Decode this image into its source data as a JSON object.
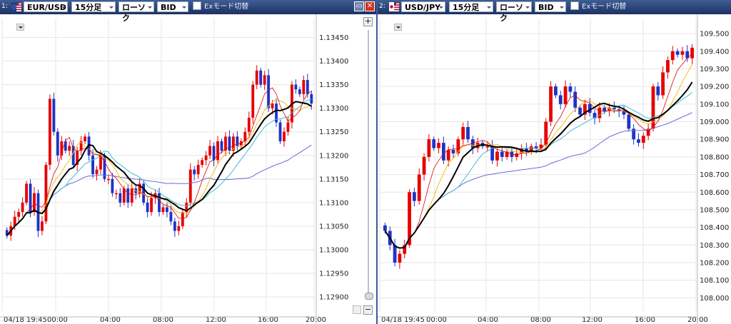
{
  "panels": [
    {
      "index": "1:",
      "pair": "EUR/USD",
      "timeframe": "15分足",
      "chart_type_label": "ローソク",
      "price_type": "BID",
      "ex_mode_label": "Exモード切替",
      "flag_icon": "eu-us-flag-icon",
      "colors": {
        "up": "#e60000",
        "down": "#1e33c8",
        "sma_fast": "#e00000",
        "sma_mid": "#f3be17",
        "sma_main": "#000000",
        "sma_cyan": "#3fbcd6",
        "sma_long": "#6a6ad6"
      },
      "chart_data": {
        "type": "candlestick",
        "yticks": [
          "1.13450",
          "1.13400",
          "1.13350",
          "1.13300",
          "1.13250",
          "1.13200",
          "1.13150",
          "1.13100",
          "1.13050",
          "1.13000",
          "1.12950",
          "1.12900"
        ],
        "ylim": [
          1.12885,
          1.13475
        ],
        "xticks": [
          "04/18 19:45",
          "00:00",
          "04:00",
          "08:00",
          "12:00",
          "16:00",
          "20:00"
        ],
        "close": [
          1.1303,
          1.1305,
          1.1307,
          1.1308,
          1.131,
          1.1314,
          1.1308,
          1.1312,
          1.1304,
          1.1306,
          1.1318,
          1.1332,
          1.1325,
          1.132,
          1.1323,
          1.1321,
          1.1322,
          1.1318,
          1.1321,
          1.1323,
          1.1324,
          1.132,
          1.1316,
          1.1317,
          1.132,
          1.1315,
          1.1315,
          1.1312,
          1.1312,
          1.131,
          1.1313,
          1.131,
          1.1313,
          1.1312,
          1.1314,
          1.131,
          1.1308,
          1.1311,
          1.1312,
          1.1308,
          1.1309,
          1.1308,
          1.1306,
          1.1304,
          1.1305,
          1.1308,
          1.131,
          1.1317,
          1.1316,
          1.1318,
          1.1319,
          1.132,
          1.1322,
          1.1319,
          1.1323,
          1.1321,
          1.1324,
          1.1321,
          1.1324,
          1.1322,
          1.1323,
          1.1325,
          1.1328,
          1.1335,
          1.1338,
          1.1335,
          1.1337,
          1.133,
          1.1331,
          1.1327,
          1.1323,
          1.1325,
          1.1327,
          1.1335,
          1.1334,
          1.1333,
          1.1336,
          1.1333,
          1.1331
        ]
      }
    },
    {
      "index": "2:",
      "pair": "USD/JPY",
      "timeframe": "15分足",
      "chart_type_label": "ローソク",
      "price_type": "BID",
      "ex_mode_label": "Exモード切替",
      "flag_icon": "jp-us-flag-icon",
      "colors": {
        "up": "#e60000",
        "down": "#1e33c8",
        "sma_fast": "#e00000",
        "sma_mid": "#f3be17",
        "sma_main": "#000000",
        "sma_cyan": "#3fbcd6",
        "sma_long": "#6a6ad6"
      },
      "chart_data": {
        "type": "candlestick",
        "yticks": [
          "109.500",
          "109.400",
          "109.300",
          "109.200",
          "109.100",
          "109.000",
          "108.900",
          "108.800",
          "108.700",
          "108.600",
          "108.500",
          "108.400",
          "108.300",
          "108.200",
          "108.100",
          "108.000"
        ],
        "ylim": [
          107.965,
          109.545
        ],
        "xticks": [
          "04/18 19:45",
          "00:00",
          "04:00",
          "08:00",
          "12:00",
          "16:00",
          "20:00"
        ],
        "close": [
          108.38,
          108.3,
          108.2,
          108.25,
          108.3,
          108.6,
          108.55,
          108.7,
          108.8,
          108.9,
          108.85,
          108.88,
          108.78,
          108.84,
          108.82,
          108.9,
          108.97,
          108.9,
          108.85,
          108.88,
          108.86,
          108.86,
          108.78,
          108.83,
          108.8,
          108.83,
          108.8,
          108.82,
          108.85,
          108.83,
          108.86,
          108.85,
          108.87,
          109.0,
          109.2,
          109.15,
          109.1,
          109.2,
          109.17,
          109.08,
          109.04,
          109.1,
          109.05,
          109.02,
          109.08,
          109.06,
          109.08,
          109.07,
          109.06,
          109.04,
          108.96,
          108.9,
          108.88,
          108.92,
          108.96,
          109.2,
          109.15,
          109.28,
          109.35,
          109.4,
          109.38,
          109.4,
          109.36,
          109.42
        ]
      }
    }
  ]
}
